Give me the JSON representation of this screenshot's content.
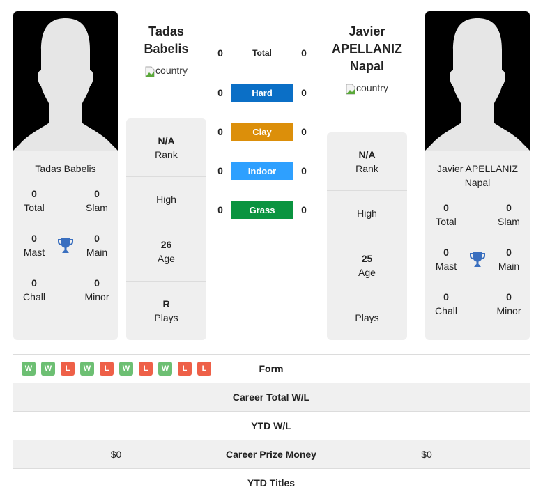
{
  "player1": {
    "name": "Tadas Babelis",
    "title_lines": [
      "Tadas",
      "Babelis"
    ],
    "country_alt": "country",
    "titles": {
      "total": {
        "value": "0",
        "label": "Total"
      },
      "slam": {
        "value": "0",
        "label": "Slam"
      },
      "mast": {
        "value": "0",
        "label": "Mast"
      },
      "main": {
        "value": "0",
        "label": "Main"
      },
      "chall": {
        "value": "0",
        "label": "Chall"
      },
      "minor": {
        "value": "0",
        "label": "Minor"
      }
    },
    "stats": {
      "rank": {
        "value": "N/A",
        "label": "Rank"
      },
      "high": {
        "value": "",
        "label": "High"
      },
      "age": {
        "value": "26",
        "label": "Age"
      },
      "plays": {
        "value": "R",
        "label": "Plays"
      }
    },
    "form": [
      "W",
      "W",
      "L",
      "W",
      "L",
      "W",
      "L",
      "W",
      "L",
      "L"
    ],
    "career_prize_money": "$0"
  },
  "player2": {
    "name": "Javier APELLANIZ Napal",
    "name_card_lines": [
      "Javier APELLANIZ",
      "Napal"
    ],
    "title_lines": [
      "Javier",
      "APELLANIZ",
      "Napal"
    ],
    "country_alt": "country",
    "titles": {
      "total": {
        "value": "0",
        "label": "Total"
      },
      "slam": {
        "value": "0",
        "label": "Slam"
      },
      "mast": {
        "value": "0",
        "label": "Mast"
      },
      "main": {
        "value": "0",
        "label": "Main"
      },
      "chall": {
        "value": "0",
        "label": "Chall"
      },
      "minor": {
        "value": "0",
        "label": "Minor"
      }
    },
    "stats": {
      "rank": {
        "value": "N/A",
        "label": "Rank"
      },
      "high": {
        "value": "",
        "label": "High"
      },
      "age": {
        "value": "25",
        "label": "Age"
      },
      "plays": {
        "value": "",
        "label": "Plays"
      }
    },
    "career_prize_money": "$0"
  },
  "surfaces": [
    {
      "label": "Total",
      "p1": "0",
      "p2": "0",
      "color": ""
    },
    {
      "label": "Hard",
      "p1": "0",
      "p2": "0",
      "color": "#0b6fc6"
    },
    {
      "label": "Clay",
      "p1": "0",
      "p2": "0",
      "color": "#dc8f0a"
    },
    {
      "label": "Indoor",
      "p1": "0",
      "p2": "0",
      "color": "#2ea0ff"
    },
    {
      "label": "Grass",
      "p1": "0",
      "p2": "0",
      "color": "#0a9440"
    }
  ],
  "h2h_rows": [
    {
      "label": "Form",
      "left": "",
      "right": ""
    },
    {
      "label": "Career Total W/L",
      "left": "",
      "right": ""
    },
    {
      "label": "YTD W/L",
      "left": "",
      "right": ""
    },
    {
      "label": "Career Prize Money",
      "left": "$0",
      "right": "$0"
    },
    {
      "label": "YTD Titles",
      "left": "",
      "right": ""
    }
  ],
  "colors": {
    "win": "#6dbf73",
    "loss": "#ee6048",
    "trophy": "#3a6fbf",
    "card_bg": "#efefef"
  }
}
